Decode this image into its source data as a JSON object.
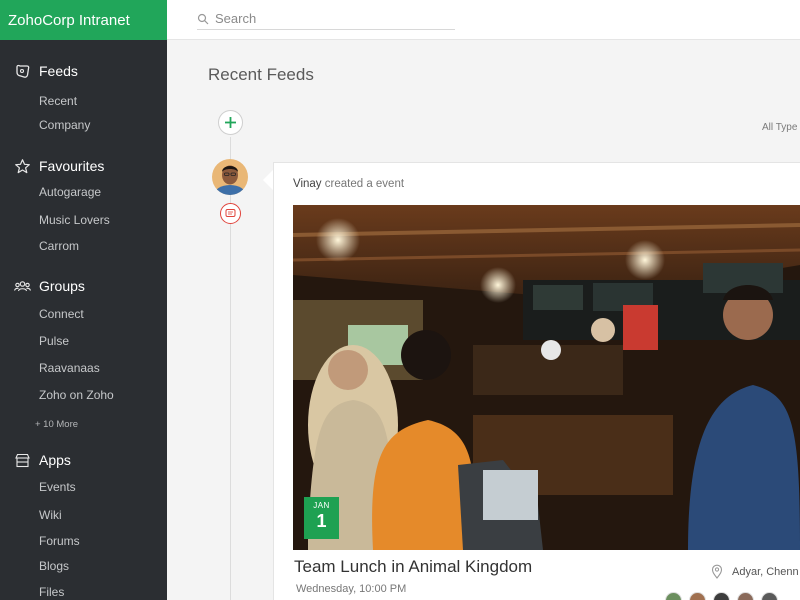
{
  "app": {
    "title": "ZohoCorp Intranet"
  },
  "search": {
    "placeholder": "Search"
  },
  "sidebar": {
    "feeds": {
      "label": "Feeds",
      "items": [
        "Recent",
        "Company"
      ]
    },
    "favourites": {
      "label": "Favourites",
      "items": [
        "Autogarage",
        "Music Lovers",
        "Carrom"
      ]
    },
    "groups": {
      "label": "Groups",
      "items": [
        "Connect",
        "Pulse",
        "Raavanaas",
        "Zoho on Zoho"
      ],
      "more": "+ 10 More"
    },
    "apps": {
      "label": "Apps",
      "items": [
        "Events",
        "Wiki",
        "Forums",
        "Blogs",
        "Files"
      ]
    }
  },
  "main": {
    "title": "Recent Feeds",
    "filter": "All Type",
    "post": {
      "user": "Vinay",
      "action": "created a event",
      "event": {
        "month": "JAN",
        "day": "1",
        "title": "Team Lunch in Animal Kingdom",
        "time": "Wednesday, 10:00 PM",
        "location": "Adyar, Chenn"
      }
    }
  },
  "colors": {
    "brand": "#21a65a",
    "sidebar": "#2b2e32",
    "badge": "#1ea152",
    "event_icon": "#e0433b"
  },
  "icons": [
    "feeds-icon",
    "star-icon",
    "groups-icon",
    "apps-icon",
    "search-icon",
    "plus-icon",
    "event-type-icon",
    "location-pin-icon"
  ]
}
